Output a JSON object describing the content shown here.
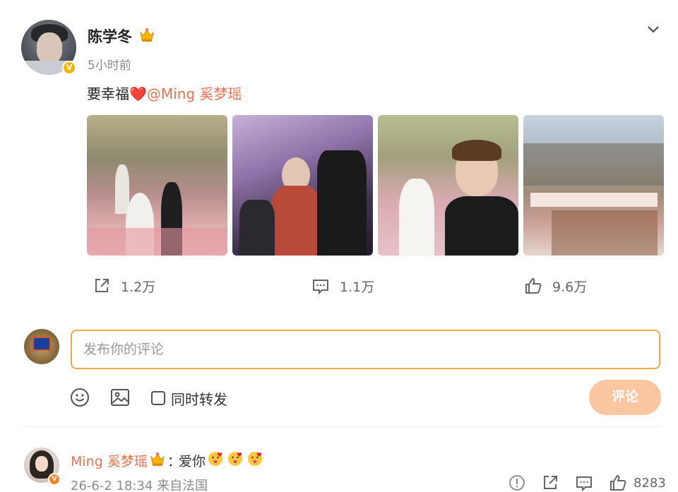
{
  "post": {
    "author": "陈学冬",
    "time": "5小时前",
    "text_prefix": "要幸福",
    "heart": "❤️",
    "mention": "@Ming 奚梦瑶",
    "images": [
      "wedding-photo-1",
      "wedding-photo-2",
      "wedding-photo-3",
      "wedding-photo-4"
    ]
  },
  "actions": {
    "repost_count": "1.2万",
    "comment_count": "1.1万",
    "like_count": "9.6万"
  },
  "comment_box": {
    "placeholder": "发布你的评论",
    "repost_label": "同时转发",
    "submit_label": "评论"
  },
  "reply": {
    "name": "Ming 奚梦瑶",
    "colon": "：",
    "text": "爱你",
    "meta": "26-6-2 18:34 来自法国",
    "likes": "8283"
  },
  "colors": {
    "accent": "#eb7350",
    "input_border": "#f3a84e",
    "submit_bg": "#fac6a0",
    "verified": "#f7b500"
  },
  "icons": [
    "crown-icon",
    "chevron-down-icon",
    "share-icon",
    "comment-icon",
    "like-icon",
    "emoji-icon",
    "image-icon",
    "report-icon",
    "kiss-emoji"
  ]
}
